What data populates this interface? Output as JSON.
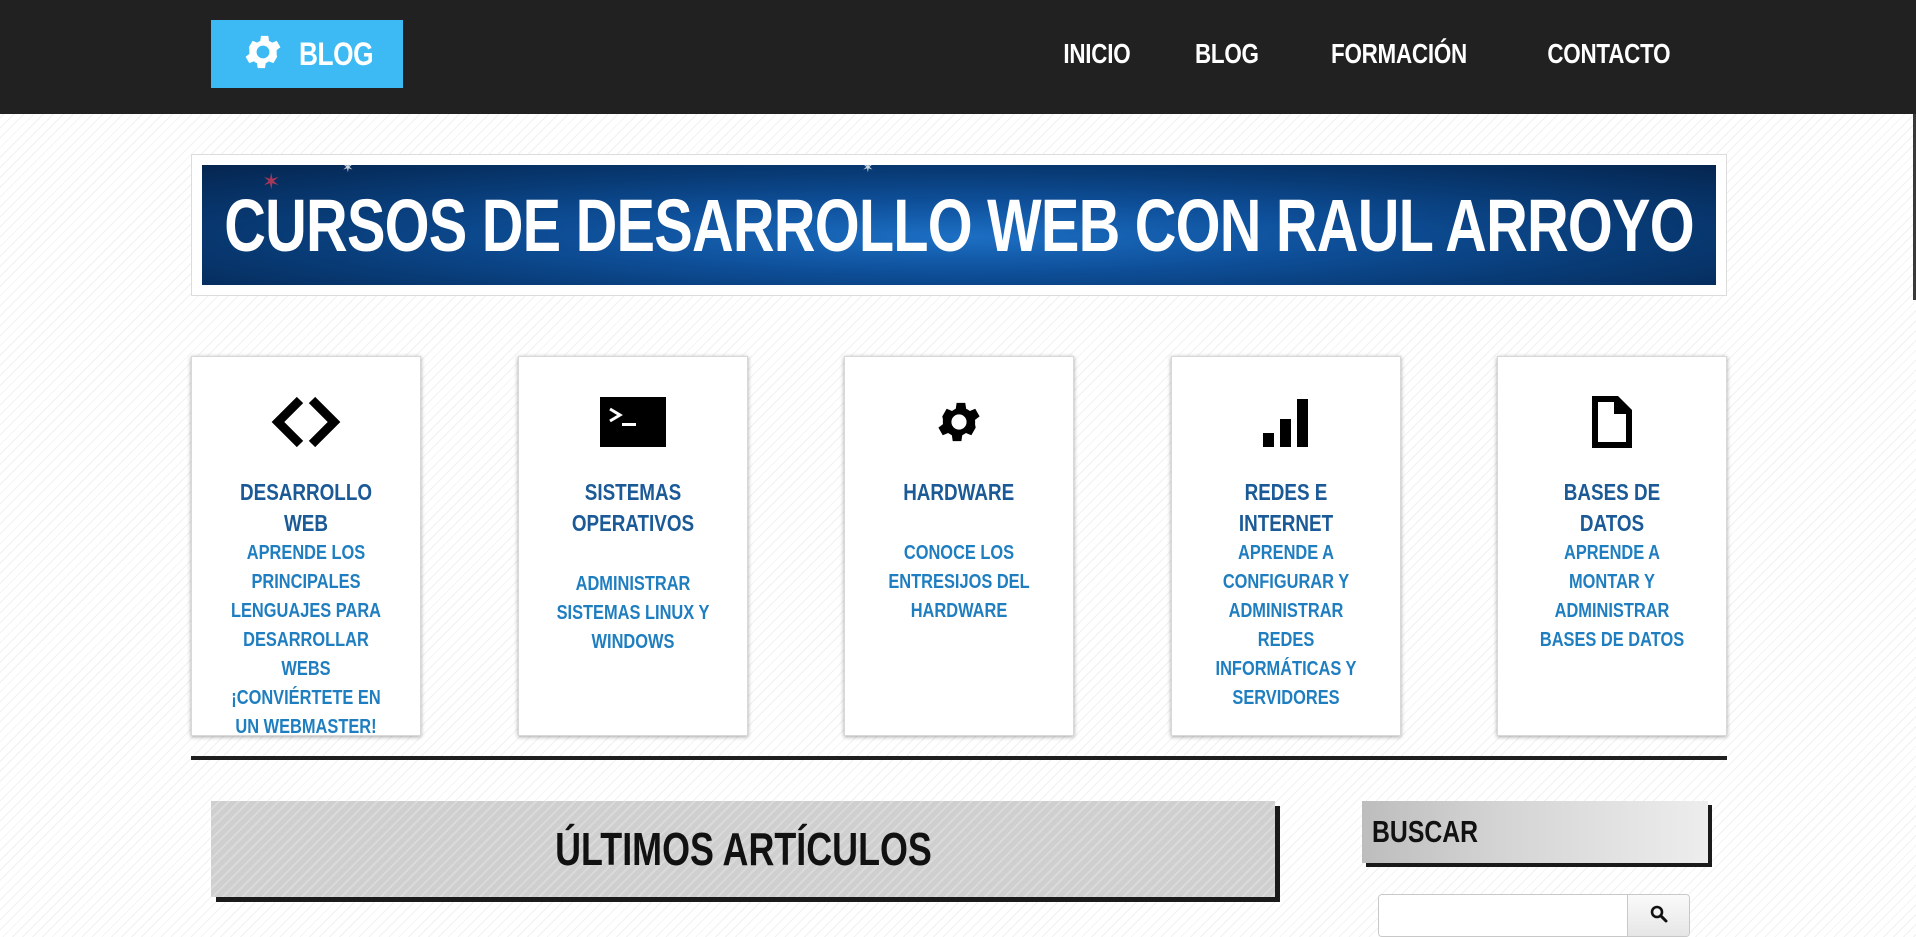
{
  "header": {
    "logo_text": "BLOG",
    "nav": [
      {
        "label": "INICIO"
      },
      {
        "label": "BLOG"
      },
      {
        "label": "FORMACIÓN"
      },
      {
        "label": "CONTACTO"
      }
    ]
  },
  "banner": {
    "title": "CURSOS DE DESARROLLO WEB CON RAUL ARROYO"
  },
  "cards": [
    {
      "icon": "code-icon",
      "title": "DESARROLLO WEB",
      "desc": "APRENDE LOS PRINCIPALES LENGUAJES PARA DESARROLLAR WEBS ¡CONVIÉRTETE EN UN WEBMASTER!"
    },
    {
      "icon": "terminal-icon",
      "title": "SISTEMAS OPERATIVOS",
      "desc": "ADMINISTRAR SISTEMAS LINUX Y WINDOWS"
    },
    {
      "icon": "gear-icon",
      "title": "HARDWARE",
      "desc": "CONOCE LOS ENTRESIJOS DEL HARDWARE"
    },
    {
      "icon": "signal-bars-icon",
      "title": "REDES E INTERNET",
      "desc": "APRENDE A CONFIGURAR Y ADMINISTRAR REDES INFORMÁTICAS Y SERVIDORES"
    },
    {
      "icon": "document-icon",
      "title": "BASES DE DATOS",
      "desc": "APRENDE A MONTAR Y ADMINISTRAR BASES DE DATOS"
    }
  ],
  "articles": {
    "title": "ÚLTIMOS ARTÍCULOS"
  },
  "sidebar": {
    "search_title": "BUSCAR",
    "search_value": "",
    "search_placeholder": ""
  },
  "colors": {
    "topbar": "#212121",
    "logo_bg": "#3dbaf3",
    "card_title": "#1b5a97",
    "card_desc": "#1f7ec0"
  }
}
